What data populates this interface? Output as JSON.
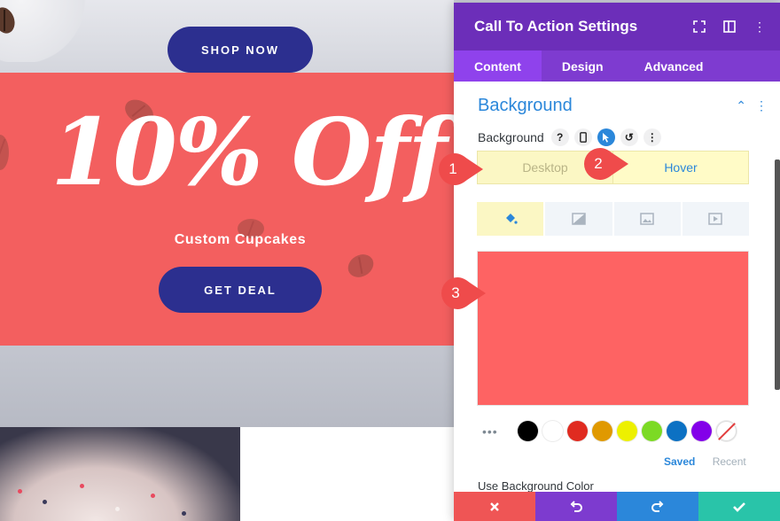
{
  "page": {
    "shop_button": "SHOP NOW",
    "promo_title": "10% Off",
    "promo_subtitle": "Custom Cupcakes",
    "deal_button": "GET DEAL",
    "promo_color": "#f35f5f",
    "button_color": "#2c2f8f"
  },
  "panel": {
    "title": "Call To Action Settings",
    "header_icons": [
      "expand-icon",
      "split-view-icon",
      "more-vertical-icon"
    ],
    "tabs": [
      "Content",
      "Design",
      "Advanced"
    ],
    "active_tab": "Content",
    "section_title": "Background",
    "background_label": "Background",
    "option_icons": [
      "help-icon",
      "responsive-icon",
      "hover-icon",
      "reset-icon",
      "more-vertical-icon"
    ],
    "mode_tabs": {
      "desktop": "Desktop",
      "hover": "Hover"
    },
    "bg_type_icons": [
      "color-fill-icon",
      "gradient-icon",
      "image-icon",
      "video-icon"
    ],
    "preview_color": "#fe6363",
    "swatches": [
      "#000000",
      "#ffffff",
      "#e02b20",
      "#e09900",
      "#edf000",
      "#7cda24",
      "#0c71c3",
      "#8300e9"
    ],
    "saved_label": "Saved",
    "recent_label": "Recent",
    "use_background_label": "Use Background Color",
    "footer_icons": [
      "cancel-icon",
      "undo-icon",
      "redo-icon",
      "save-icon"
    ]
  },
  "annotations": {
    "marker_1": "1",
    "marker_2": "2",
    "marker_3": "3"
  },
  "colors": {
    "panel_header": "#6c2eb9",
    "accent": "#2b87da",
    "marker": "#ef4b4b"
  }
}
